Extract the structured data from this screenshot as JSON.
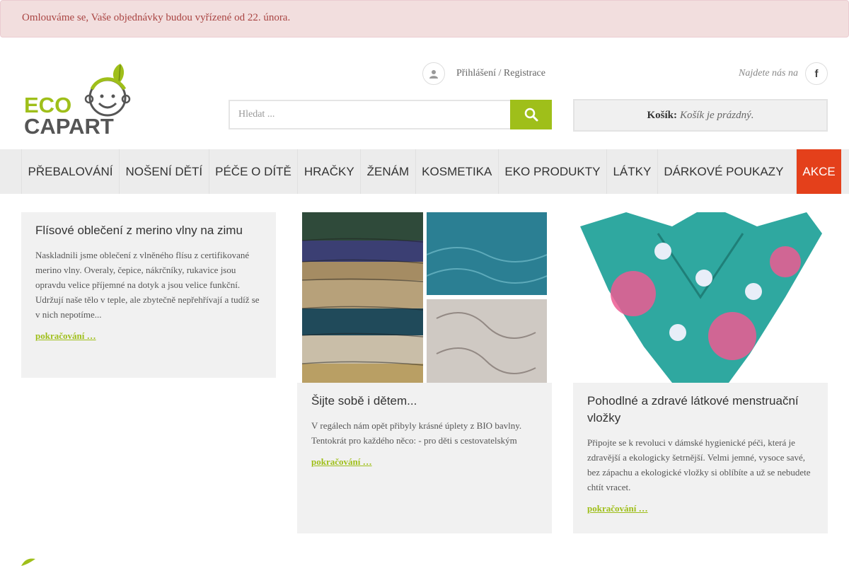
{
  "notice": {
    "text": "Omlouváme se, Vaše objednávky budou vyřízené od 22. února."
  },
  "header": {
    "logo": {
      "line1": "ECO",
      "line2": "CAPART"
    },
    "login": {
      "login_label": "Přihlášení",
      "separator": " / ",
      "register_label": "Registrace"
    },
    "find_us": {
      "label": "Najdete nás na",
      "social_icon": "facebook-icon"
    },
    "search": {
      "placeholder": "Hledat ...",
      "icon": "search-icon"
    },
    "cart": {
      "label": "Košík:",
      "status": "Košík je prázdný."
    }
  },
  "nav": {
    "items": [
      {
        "label": "PŘEBALOVÁNÍ"
      },
      {
        "label": "NOŠENÍ DĚTÍ"
      },
      {
        "label": "PÉČE O DÍTĚ"
      },
      {
        "label": "HRAČKY"
      },
      {
        "label": "ŽENÁM"
      },
      {
        "label": "KOSMETIKA"
      },
      {
        "label": "EKO PRODUKTY"
      },
      {
        "label": "LÁTKY"
      },
      {
        "label": "DÁRKOVÉ POUKAZY"
      },
      {
        "label": "AKCE"
      }
    ]
  },
  "articles": [
    {
      "title": "Flísové oblečení z merino vlny na zimu",
      "excerpt": "Naskladnili jsme oblečení z vlněného flísu z certifikované merino vlny. Overaly, čepice, nákrčníky, rukavice jsou opravdu velice příjemné na dotyk a jsou velice funkční. Udržují naše tělo v teple, ale zbytečně nepřehřívají a tudíž se v nich nepotíme...",
      "more": "pokračování …"
    },
    {
      "title": "Šijte sobě i dětem...",
      "excerpt": "V regálech nám opět přibyly krásné úplety z BIO bavlny. Tentokrát pro každého něco: - pro děti s cestovatelským",
      "more": "pokračování …"
    },
    {
      "title": "Pohodlné a zdravé látkové menstruační vložky",
      "excerpt": "Připojte se k revoluci v dámské hygienické péči, která je zdravější a ekologicky šetrnější. Velmi jemné, vysoce savé, bez zápachu a ekologické vložky si oblíbíte a už se nebudete chtít vracet.",
      "more": "pokračování …"
    }
  ],
  "colors": {
    "accent": "#9fbf1a",
    "sale": "#e4401b",
    "notice_text": "#a94442",
    "notice_bg": "#f2dede"
  }
}
